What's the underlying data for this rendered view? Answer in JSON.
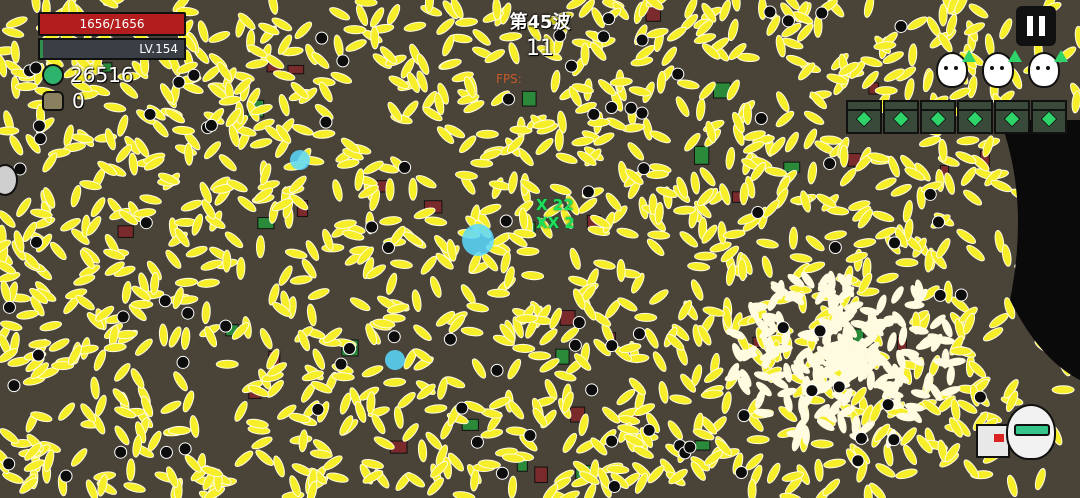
{
  "hud": {
    "hp_text": "1656/1656",
    "hp_fraction": 1.0,
    "level_text": "LV.154",
    "xp_fraction": 0.02,
    "coins": "26516",
    "bag_count": "0",
    "wave_label": "第45波",
    "timer": "11",
    "fps_label": "FPS:"
  },
  "combat": {
    "combo_line1": "X 22",
    "combo_line2": "XX 2"
  },
  "colors": {
    "ground": "#4a4438",
    "bullet": "#f6ee28",
    "bullet_core": "#fffbe0",
    "orb": "#0d0d0d",
    "hp": "#b31d1d",
    "xp": "#2f8f4d",
    "accent_green": "#2ed36a"
  },
  "icons": [
    "heart-bar-icon",
    "coin-icon",
    "bag-icon",
    "pause-icon",
    "egg-upgrade-icon",
    "chest-icon",
    "player-egg-icon",
    "gun-icon"
  ],
  "upgrade_eggs": 3,
  "chests": 6
}
